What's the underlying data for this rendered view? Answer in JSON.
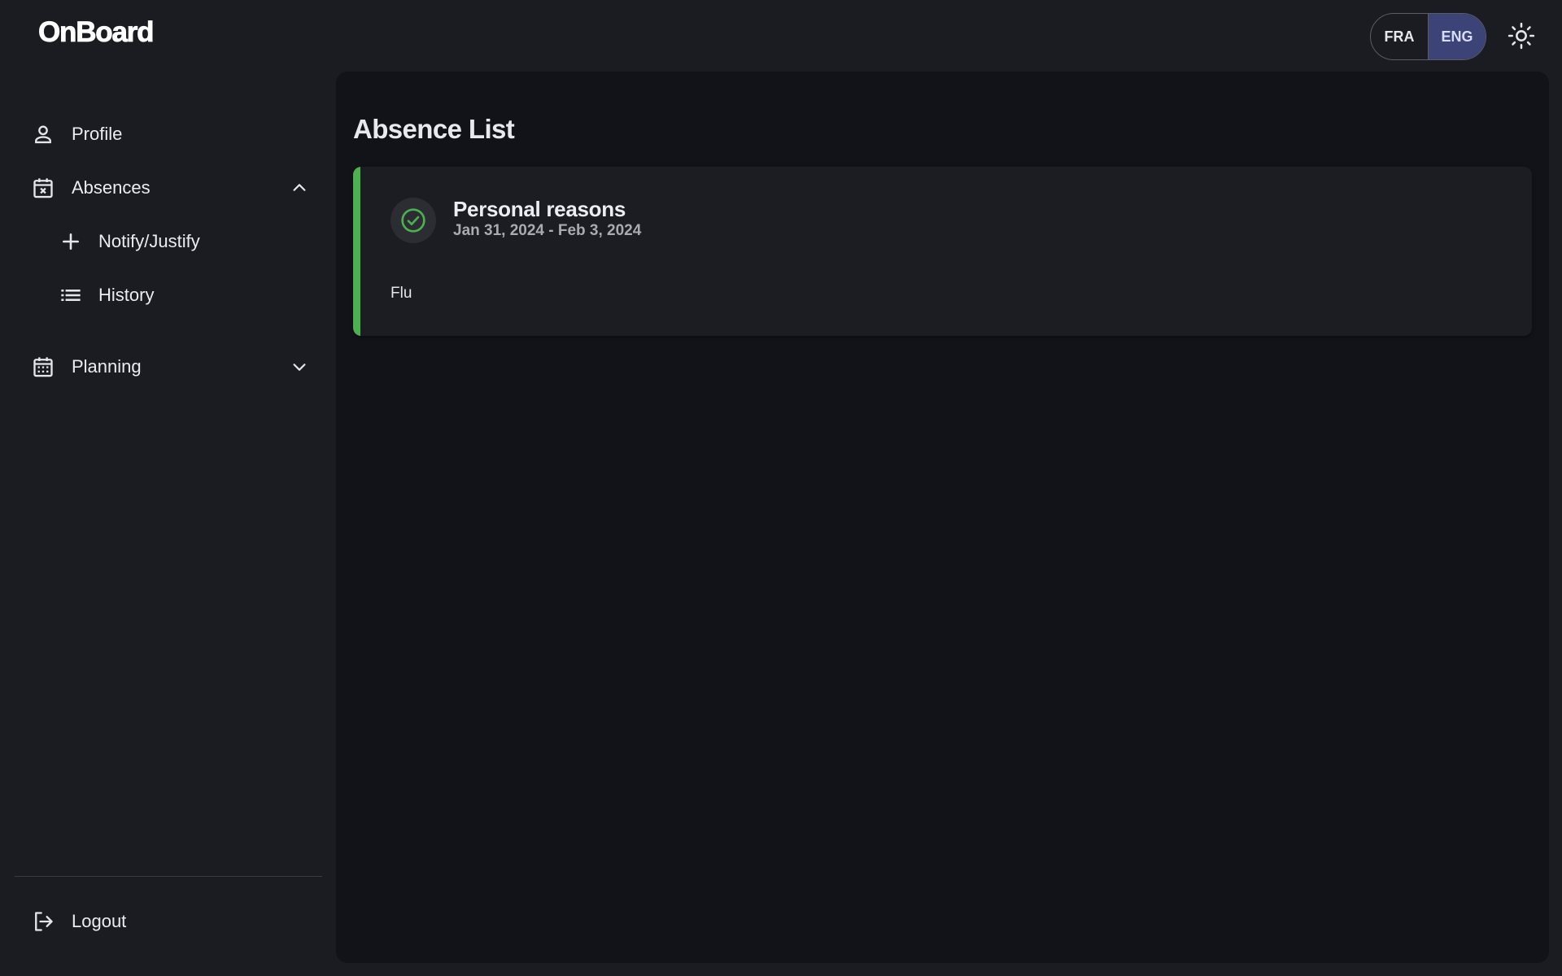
{
  "app": {
    "title": "OnBoard"
  },
  "header": {
    "languages": [
      {
        "code": "FRA",
        "active": false
      },
      {
        "code": "ENG",
        "active": true
      }
    ],
    "theme_toggle_icon": "sun-icon"
  },
  "sidebar": {
    "items": [
      {
        "label": "Profile",
        "icon": "person-icon"
      },
      {
        "label": "Absences",
        "icon": "calendar-x-icon",
        "expanded": true,
        "children": [
          {
            "label": "Notify/Justify",
            "icon": "plus-icon"
          },
          {
            "label": "History",
            "icon": "list-icon"
          }
        ]
      },
      {
        "label": "Planning",
        "icon": "calendar-grid-icon",
        "expanded": false
      }
    ],
    "logout_label": "Logout"
  },
  "main": {
    "title": "Absence List",
    "absences": [
      {
        "reason": "Personal reasons",
        "dates": "Jan 31, 2024 - Feb 3, 2024",
        "comment": "Flu",
        "status": "approved",
        "status_icon": "check-circle-icon",
        "status_color": "#4caf50"
      }
    ]
  },
  "colors": {
    "background": "#1b1c21",
    "panel": "#121318",
    "card": "#1c1d22",
    "active_language": "#3b4377",
    "approved": "#4caf50"
  }
}
